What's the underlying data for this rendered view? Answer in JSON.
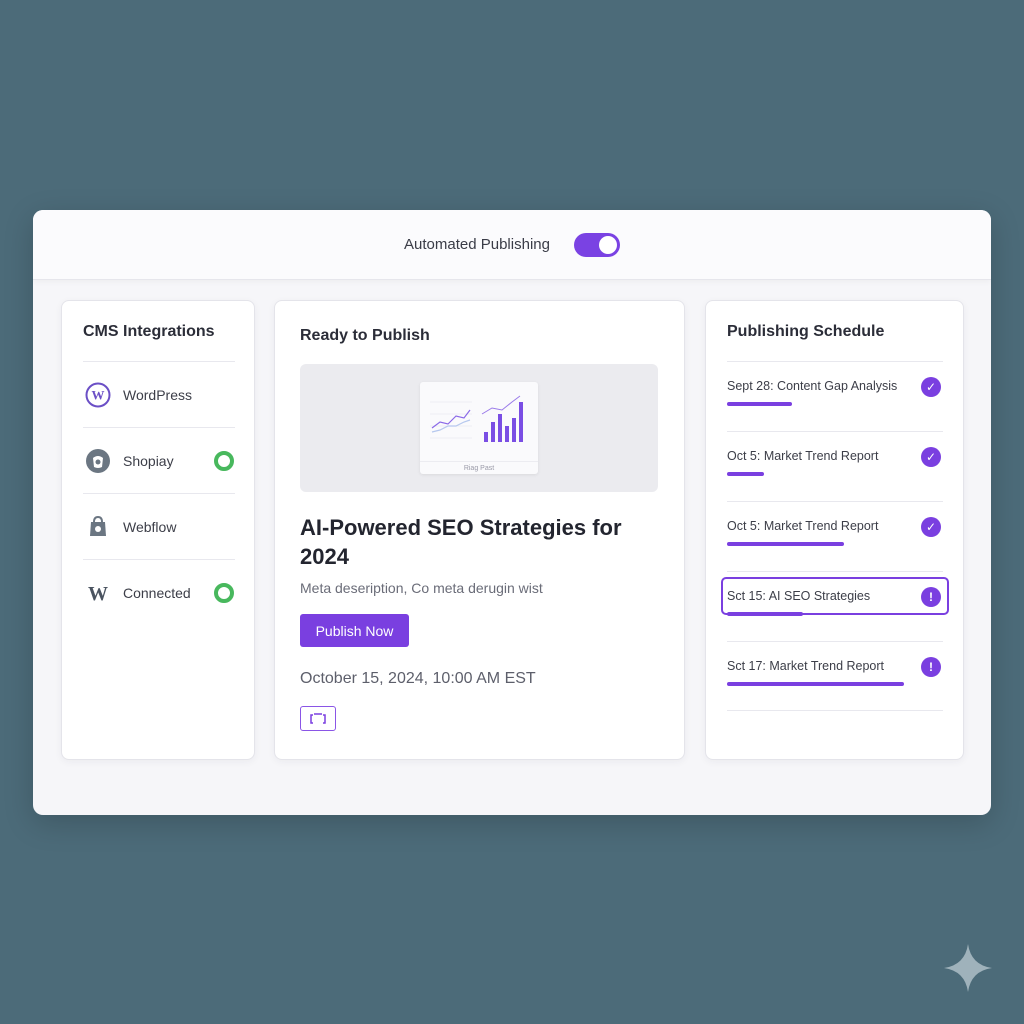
{
  "topbar": {
    "label": "Automated Publishing",
    "toggle_on": true
  },
  "cms": {
    "title": "CMS Integrations",
    "items": [
      {
        "name": "WordPress",
        "icon": "wordpress-icon",
        "connected": false
      },
      {
        "name": "Shopiay",
        "icon": "shopify-icon",
        "connected": true
      },
      {
        "name": "Webflow",
        "icon": "webflow-icon",
        "connected": false
      },
      {
        "name": "Connected",
        "icon": "w-logo-icon",
        "connected": true
      }
    ]
  },
  "publish": {
    "title": "Ready to Publish",
    "image_caption": "Riag Past",
    "article_title": "AI-Powered SEO Strategies for 2024",
    "meta_description": "Meta deseription, Co meta derugin wist",
    "button_label": "Publish Now",
    "scheduled_date": "October 15, 2024, 10:00 AM EST"
  },
  "schedule": {
    "title": "Publishing Schedule",
    "items": [
      {
        "label": "Sept 28: Content Gap Analysis",
        "status": "done",
        "progress": 0.3
      },
      {
        "label": "Oct 5: Market Trend Report",
        "status": "done",
        "progress": 0.17
      },
      {
        "label": "Oct 5: Market Trend Report",
        "status": "done",
        "progress": 0.54
      },
      {
        "label": "Sct 15: AI SEO Strategies",
        "status": "warning",
        "progress": 0.35,
        "selected": true
      },
      {
        "label": "Sct 17: Market Trend Report",
        "status": "warning",
        "progress": 0.82
      }
    ]
  },
  "colors": {
    "accent": "#7a3fe0",
    "connected": "#48b85d",
    "background": "#4c6b79"
  }
}
